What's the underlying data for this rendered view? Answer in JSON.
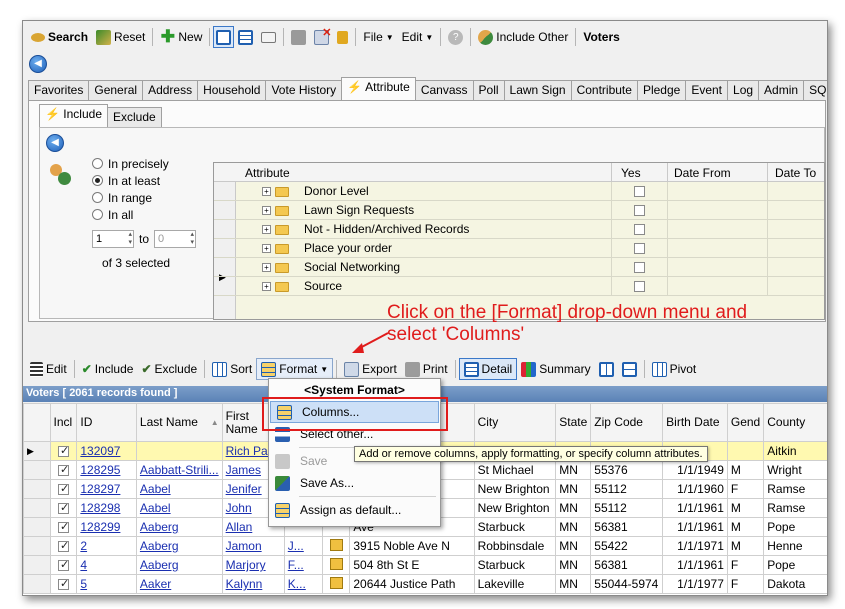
{
  "toolbar1": {
    "search": "Search",
    "reset": "Reset",
    "new": "New",
    "file": "File",
    "edit": "Edit",
    "include_other": "Include Other",
    "voters": "Voters"
  },
  "tabs": [
    "Favorites",
    "General",
    "Address",
    "Household",
    "Vote History",
    "Attribute",
    "Canvass",
    "Poll",
    "Lawn Sign",
    "Contribute",
    "Pledge",
    "Event",
    "Log",
    "Admin",
    "SQL"
  ],
  "subtabs": {
    "include": "Include",
    "exclude": "Exclude"
  },
  "radios": {
    "precisely": "In precisely",
    "at_least": "In at least",
    "range": "In range",
    "all": "In all"
  },
  "range": {
    "from": "1",
    "to_label": "to",
    "to": "0",
    "selected": "of 3 selected"
  },
  "attr_grid": {
    "headers": {
      "attribute": "Attribute",
      "yes": "Yes",
      "date_from": "Date From",
      "date_to": "Date To"
    },
    "rows": [
      "Donor Level",
      "Lawn Sign Requests",
      "Not - Hidden/Archived Records",
      "Place your order",
      "Social Networking",
      "Source"
    ]
  },
  "annotation": {
    "line1": "Click on the [Format] drop-down menu and",
    "line2": "select 'Columns'"
  },
  "toolbar2": {
    "edit": "Edit",
    "include": "Include",
    "exclude": "Exclude",
    "sort": "Sort",
    "format": "Format",
    "export": "Export",
    "print": "Print",
    "detail": "Detail",
    "summary": "Summary",
    "pivot": "Pivot"
  },
  "voters_bar": "Voters [ 2061 records found ]",
  "grid": {
    "headers": {
      "incl": "Incl",
      "id": "ID",
      "last": "Last Name",
      "first": "First Name",
      "city": "City",
      "state": "State",
      "zip": "Zip Code",
      "birth": "Birth Date",
      "gend": "Gend",
      "county": "County"
    },
    "rows": [
      {
        "id": "132097",
        "last": "",
        "first": "Rich Pac",
        "mid": "",
        "addr": "",
        "city": "",
        "state": "",
        "zip": "",
        "birth": "",
        "gend": "",
        "county": "Aitkin"
      },
      {
        "id": "128295",
        "last": "Aabbatt-Strili...",
        "first": "James",
        "mid": "",
        "addr": "Mark Rd ...",
        "city": "St Michael",
        "state": "MN",
        "zip": "55376",
        "birth": "1/1/1949",
        "gend": "M",
        "county": "Wright"
      },
      {
        "id": "128297",
        "last": "Aabel",
        "first": "Jenifer",
        "mid": "",
        "addr": "Blvd",
        "city": "New Brighton",
        "state": "MN",
        "zip": "55112",
        "birth": "1/1/1960",
        "gend": "F",
        "county": "Ramse"
      },
      {
        "id": "128298",
        "last": "Aabel",
        "first": "John",
        "mid": "",
        "addr": "Blvd",
        "city": "New Brighton",
        "state": "MN",
        "zip": "55112",
        "birth": "1/1/1961",
        "gend": "M",
        "county": "Ramse"
      },
      {
        "id": "128299",
        "last": "Aaberg",
        "first": "Allan",
        "mid": "",
        "addr": "Ave",
        "city": "Starbuck",
        "state": "MN",
        "zip": "56381",
        "birth": "1/1/1961",
        "gend": "M",
        "county": "Pope"
      },
      {
        "id": "2",
        "last": "Aaberg",
        "first": "Jamon",
        "mid": "J...",
        "addr": "3915 Noble Ave N",
        "city": "Robbinsdale",
        "state": "MN",
        "zip": "55422",
        "birth": "1/1/1971",
        "gend": "M",
        "county": "Henne"
      },
      {
        "id": "4",
        "last": "Aaberg",
        "first": "Marjory",
        "mid": "F...",
        "addr": "504 8th St E",
        "city": "Starbuck",
        "state": "MN",
        "zip": "56381",
        "birth": "1/1/1961",
        "gend": "F",
        "county": "Pope"
      },
      {
        "id": "5",
        "last": "Aaker",
        "first": "Kalynn",
        "mid": "K...",
        "addr": "20644 Justice Path",
        "city": "Lakeville",
        "state": "MN",
        "zip": "55044-5974",
        "birth": "1/1/1977",
        "gend": "F",
        "county": "Dakota"
      }
    ]
  },
  "format_menu": {
    "system_format": "<System Format>",
    "columns": "Columns...",
    "select_other": "Select other...",
    "save": "Save",
    "save_as": "Save As...",
    "assign_default": "Assign as default..."
  },
  "tooltip": "Add or remove columns, apply formatting, or specify column attributes."
}
